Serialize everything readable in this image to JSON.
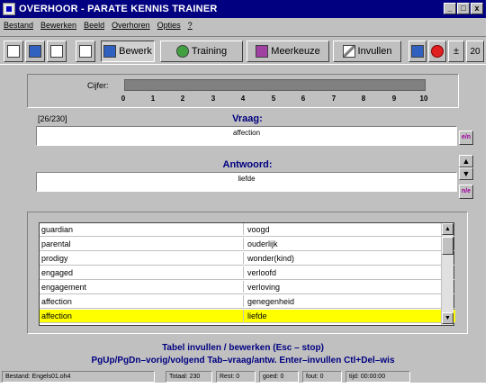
{
  "window": {
    "title": "OVERHOOR - PARATE KENNIS TRAINER",
    "controls": [
      "_",
      "□",
      "x"
    ]
  },
  "menu": [
    "Bestand",
    "Bewerken",
    "Beeld",
    "Overhoren",
    "Opties",
    "?"
  ],
  "toolbar": {
    "bewerk_label": "Bewerk",
    "training_label": "Training",
    "meerkeuze_label": "Meerkeuze",
    "invullen_label": "Invullen",
    "plusminus_label": "±",
    "number_label": "20"
  },
  "score": {
    "label": "Cijfer:",
    "ticks": [
      "0",
      "1",
      "2",
      "3",
      "4",
      "5",
      "6",
      "7",
      "8",
      "9",
      "10"
    ]
  },
  "qa": {
    "counter": "[26/230]",
    "question_label": "Vraag:",
    "question": "affection",
    "answer_label": "Antwoord:",
    "answer": "liefde"
  },
  "list": {
    "rows": [
      {
        "term": "guardian",
        "translation": "voogd",
        "selected": false
      },
      {
        "term": "parental",
        "translation": "ouderlijk",
        "selected": false
      },
      {
        "term": "prodigy",
        "translation": "wonder(kind)",
        "selected": false
      },
      {
        "term": "engaged",
        "translation": "verloofd",
        "selected": false
      },
      {
        "term": "engagement",
        "translation": "verloving",
        "selected": false
      },
      {
        "term": "affection",
        "translation": "genegenheid",
        "selected": false
      },
      {
        "term": "affection",
        "translation": "liefde",
        "selected": true
      }
    ]
  },
  "help": {
    "line1": "Tabel invullen / bewerken (Esc – stop)",
    "line2": "PgUp/PgDn–vorig/volgend  Tab–vraag/antw.  Enter–invullen  Ctl+Del–wis"
  },
  "status": {
    "file": "Bestand: Engels01.oh4",
    "total": "Totaal: 230",
    "rest": "Rest: 0",
    "good": "goed: 0",
    "wrong": "fout: 0",
    "time": "tijd: 00:00:00"
  },
  "colors": {
    "titlebar": "#000080",
    "highlight": "#ffff00",
    "label": "#000080"
  }
}
